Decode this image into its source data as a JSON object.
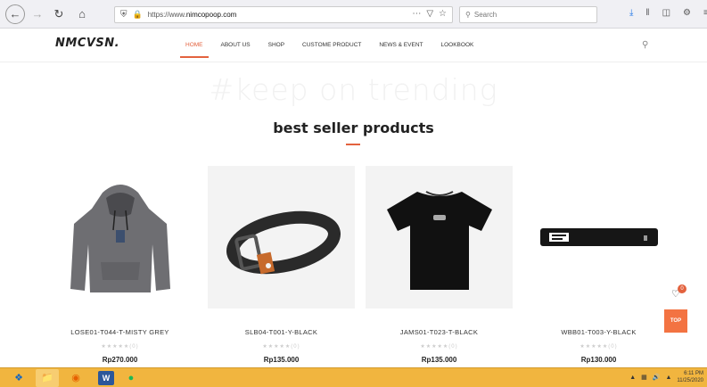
{
  "browser": {
    "url_prefix": "https://www.",
    "url_domain": "nimcopoop.com",
    "search_placeholder": "Search",
    "more_icon": "⋯",
    "pocket_icon": "▽",
    "star_icon": "☆"
  },
  "site": {
    "logo": "NMCVSN.",
    "menu": [
      "HOME",
      "ABOUT US",
      "SHOP",
      "CUSTOME PRODUCT",
      "NEWS & EVENT",
      "LOOKBOOK"
    ],
    "active_menu": "HOME",
    "background_text": "#keep on trending",
    "section_title": "best seller products",
    "accent_color": "#e3623e"
  },
  "products": [
    {
      "name": "LOSE01-T044-T-MISTY GREY",
      "rating_count": "(0)",
      "price": "Rp270.000"
    },
    {
      "name": "SLB04-T001-Y-BLACK",
      "rating_count": "(0)",
      "price": "Rp135.000"
    },
    {
      "name": "JAMS01-T023-T-BLACK",
      "rating_count": "(0)",
      "price": "Rp135.000"
    },
    {
      "name": "WBB01-T003-Y-BLACK",
      "rating_count": "(0)",
      "price": "Rp130.000"
    }
  ],
  "floating": {
    "wishlist_count": "0",
    "top_label": "TOP"
  },
  "taskbar": {
    "time": "6:11 PM",
    "date": "11/25/2020"
  }
}
